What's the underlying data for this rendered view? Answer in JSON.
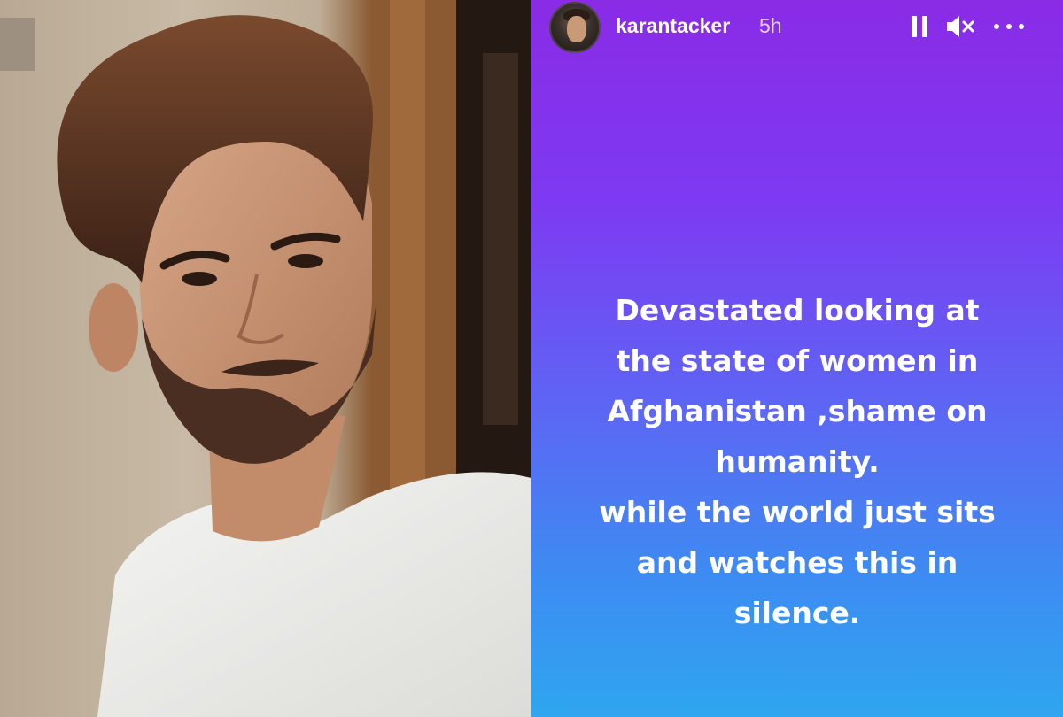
{
  "story": {
    "username": "karantacker",
    "time_ago": "5h",
    "text_lines": [
      "Devastated looking at",
      "the state of women in",
      "Afghanistan ,shame on",
      "humanity.",
      "while the world just sits",
      "and watches this in",
      "silence."
    ]
  },
  "controls": {
    "pause_icon": "pause-icon",
    "mute_icon": "speaker-muted-icon",
    "more_icon": "more-horizontal-icon"
  },
  "colors": {
    "story_gradient_top": "#8a2be6",
    "story_gradient_mid": "#5f63f4",
    "story_gradient_bottom": "#2fa6ef",
    "text": "#ffffff"
  }
}
